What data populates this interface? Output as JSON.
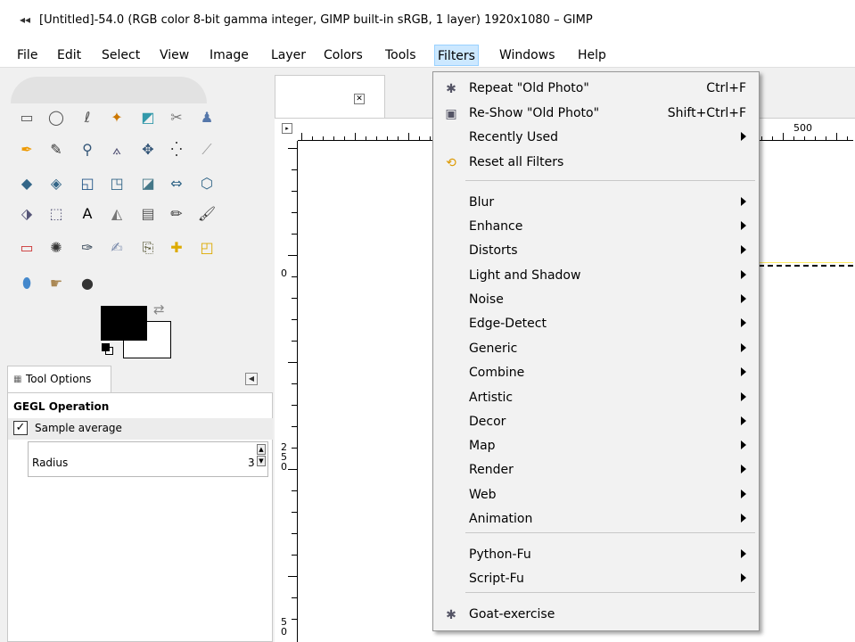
{
  "window": {
    "title": "[Untitled]-54.0 (RGB color 8-bit gamma integer, GIMP built-in sRGB, 1 layer) 1920x1080 – GIMP",
    "app_icon": "gimp-wilber-icon"
  },
  "menubar": {
    "items": [
      "File",
      "Edit",
      "Select",
      "View",
      "Image",
      "Layer",
      "Colors",
      "Tools",
      "Filters",
      "Windows",
      "Help"
    ],
    "active": "Filters"
  },
  "toolbox": {
    "tool_icons": [
      "rect-select-icon",
      "ellipse-select-icon",
      "free-select-icon",
      "fuzzy-select-icon",
      "by-color-select-icon",
      "scissors-select-icon",
      "foreground-select-icon",
      "paths-icon",
      "color-picker-icon",
      "zoom-icon",
      "measure-icon",
      "move-icon",
      "align-icon",
      "transform-icon",
      "unified-transform-icon",
      "rotate-icon",
      "scale-icon",
      "shear-icon",
      "perspective-icon",
      "flip-icon",
      "cage-icon",
      "warp-icon",
      "handle-transform-icon",
      "text-icon",
      "bucket-fill-icon",
      "gradient-icon",
      "pencil-icon",
      "paintbrush-icon",
      "eraser-icon",
      "airbrush-icon",
      "ink-icon",
      "mypaint-brush-icon",
      "clone-icon",
      "heal-icon",
      "perspective-clone-icon",
      "blur-icon",
      "smudge-icon",
      "dodge-burn-icon"
    ],
    "fg_color": "#000000",
    "bg_color": "#ffffff"
  },
  "tool_options": {
    "tab_label": "Tool Options",
    "section_title": "GEGL Operation",
    "sample_average_label": "Sample average",
    "sample_average_checked": true,
    "radius_label": "Radius",
    "radius_value": "3"
  },
  "canvas": {
    "ruler_top_label": "500",
    "ruler_left_labels": [
      "0",
      "2\n5\n0",
      "5\n0"
    ]
  },
  "filters_menu": {
    "items": [
      {
        "label": "Repeat \"Old Photo\"",
        "accel": "Ctrl+F",
        "icon": "gear-filter-icon"
      },
      {
        "label": "Re-Show \"Old Photo\"",
        "accel": "Shift+Ctrl+F",
        "icon": "reshow-filter-icon"
      },
      {
        "label": "Recently Used",
        "submenu": true
      },
      {
        "label": "Reset all Filters",
        "icon": "reset-filters-icon"
      },
      {
        "label": "Blur",
        "submenu": true
      },
      {
        "label": "Enhance",
        "submenu": true
      },
      {
        "label": "Distorts",
        "submenu": true
      },
      {
        "label": "Light and Shadow",
        "submenu": true
      },
      {
        "label": "Noise",
        "submenu": true
      },
      {
        "label": "Edge-Detect",
        "submenu": true
      },
      {
        "label": "Generic",
        "submenu": true
      },
      {
        "label": "Combine",
        "submenu": true
      },
      {
        "label": "Artistic",
        "submenu": true
      },
      {
        "label": "Decor",
        "submenu": true
      },
      {
        "label": "Map",
        "submenu": true
      },
      {
        "label": "Render",
        "submenu": true
      },
      {
        "label": "Web",
        "submenu": true
      },
      {
        "label": "Animation",
        "submenu": true
      },
      {
        "label": "Python-Fu",
        "submenu": true
      },
      {
        "label": "Script-Fu",
        "submenu": true
      },
      {
        "label": "Goat-exercise",
        "icon": "gear-filter-icon"
      }
    ]
  },
  "colors": {
    "menu_highlight": "#cce8ff",
    "menu_highlight_border": "#99d1ff",
    "dropdown_bg": "#f2f2f2"
  }
}
